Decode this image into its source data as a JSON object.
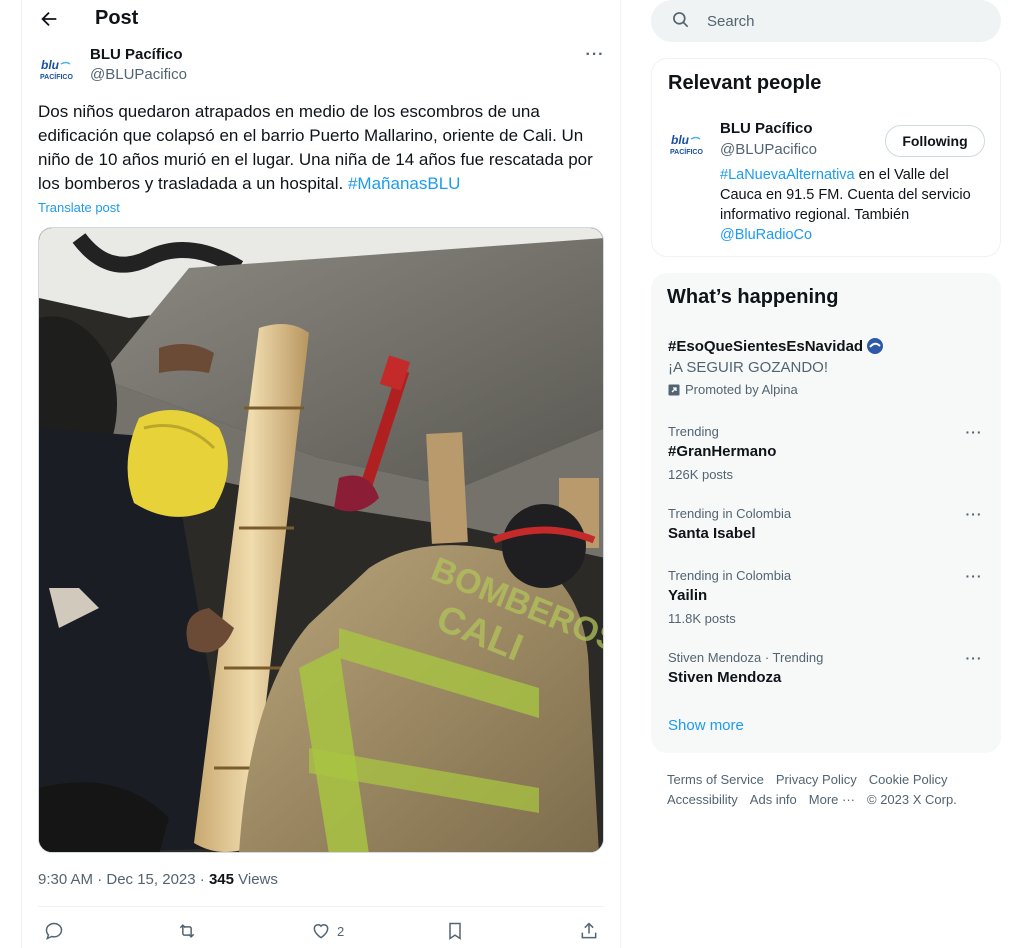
{
  "header": {
    "title": "Post"
  },
  "post": {
    "author_name": "BLU Pacífico",
    "author_handle": "@BLUPacifico",
    "text": "Dos niños quedaron atrapados en medio de los escombros de una edificación que colapsó en el barrio Puerto Mallarino, oriente de Cali. Un niño de 10 años murió en el lugar. Una niña de 14 años fue rescatada por los bomberos y trasladada a un hospital. ",
    "hashtag": "#MañanasBLU",
    "translate_label": "Translate post",
    "time": "9:30 AM · Dec 15, 2023 · ",
    "views_count": "345",
    "views_label": " Views",
    "likes_count": "2",
    "media_text_1": "BOMBEROS",
    "media_text_2": "CALI"
  },
  "logo_text": {
    "top": "blu",
    "bottom": "PACÍFICO"
  },
  "search": {
    "placeholder": "Search"
  },
  "relevant_people": {
    "title": "Relevant people",
    "name": "BLU Pacífico",
    "handle": "@BLUPacifico",
    "follow_label": "Following",
    "bio_link1": "#LaNuevaAlternativa",
    "bio_text": " en el Valle del Cauca en 91.5 FM. Cuenta del servicio informativo regional. También ",
    "bio_link2": "@BluRadioCo"
  },
  "happening": {
    "title": "What’s happening",
    "promo": {
      "name": "#EsoQueSientesEsNavidad",
      "subtitle": "¡A SEGUIR GOZANDO!",
      "promoted_by": "Promoted by Alpina"
    },
    "trends": [
      {
        "context": "Trending",
        "name": "#GranHermano",
        "count": "126K posts"
      },
      {
        "context": "Trending in Colombia",
        "name": "Santa Isabel",
        "count": ""
      },
      {
        "context": "Trending in Colombia",
        "name": "Yailin",
        "count": "11.8K posts"
      },
      {
        "context": "Stiven Mendoza · Trending",
        "name": "Stiven Mendoza",
        "count": ""
      }
    ],
    "show_more": "Show more"
  },
  "footer": {
    "links": [
      "Terms of Service",
      "Privacy Policy",
      "Cookie Policy",
      "Accessibility",
      "Ads info",
      "More ···"
    ],
    "copyright": "© 2023 X Corp."
  },
  "icons": {
    "back": "arrow-left-icon",
    "search": "search-icon",
    "more": "more-horizontal-icon",
    "reply": "reply-icon",
    "repost": "repost-icon",
    "like": "heart-icon",
    "bookmark": "bookmark-icon",
    "share": "share-icon"
  },
  "colors": {
    "accent": "#1d9bf0",
    "text": "#0f1419",
    "muted": "#536471"
  }
}
